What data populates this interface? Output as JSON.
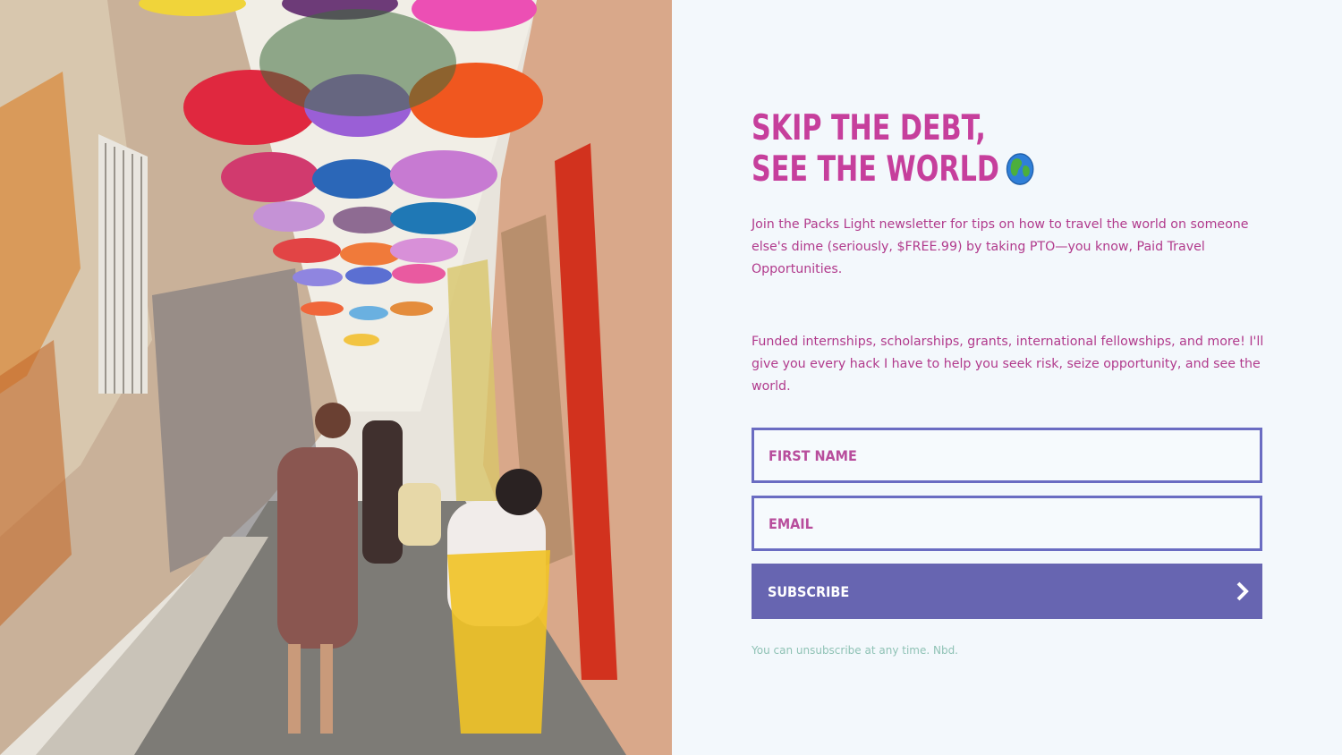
{
  "hero_image": {
    "description_icon": "umbrella-alley-photo"
  },
  "headline": {
    "line1": "SKIP THE DEBT,",
    "line2": "SEE THE WORLD"
  },
  "intro": "Join the Packs Light newsletter for tips on how to travel the world on someone else's dime (seriously, $FREE.99) by taking PTO—you know, Paid Travel Opportunities.",
  "details": "Funded internships, scholarships, grants, international fellowships, and more! I'll give you every hack I have to help you seek risk, seize opportunity, and see the world.",
  "form": {
    "first_name_placeholder": "FIRST NAME",
    "email_placeholder": "EMAIL",
    "subscribe_label": "SUBSCRIBE"
  },
  "note": "You can unsubscribe at any time. Nbd.",
  "colors": {
    "accent_pink": "#c63f9c",
    "button_purple": "#6765b1",
    "field_border": "#6a6cc2",
    "note_green": "#8fc2b5",
    "background": "#f3f8fc"
  }
}
